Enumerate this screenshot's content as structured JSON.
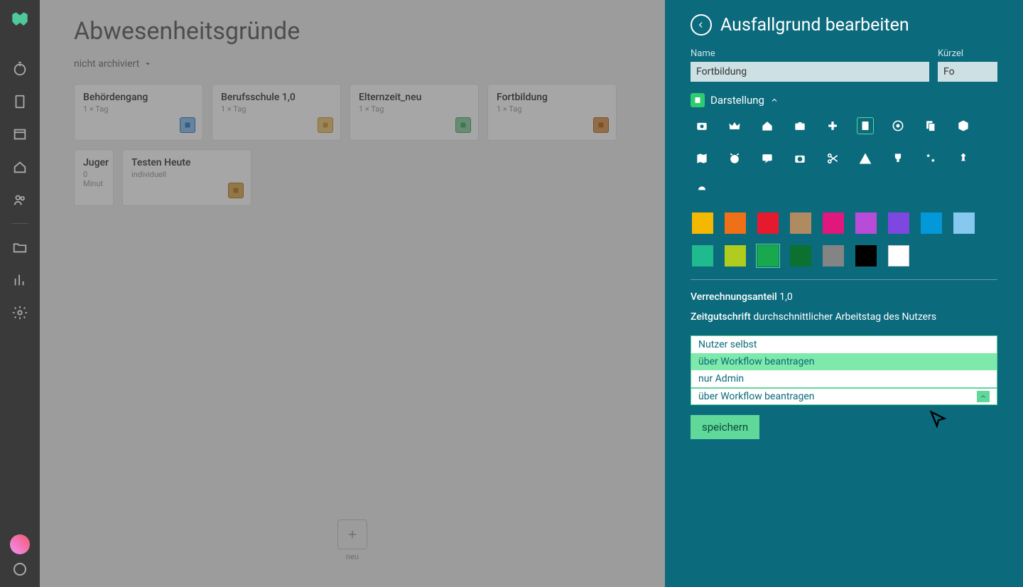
{
  "page": {
    "title": "Abwesenheitsgründe",
    "filter": "nicht archiviert",
    "newLabel": "neu"
  },
  "cards": [
    {
      "title": "Behördengang",
      "sub": "1 × Tag",
      "badgeColor": "#a3c9f0",
      "badgeBorder": "#4b8fd6"
    },
    {
      "title": "Berufsschule 1,0",
      "sub": "1 × Tag",
      "badgeColor": "#f0d090",
      "badgeBorder": "#d4a850"
    },
    {
      "title": "Elternzeit_neu",
      "sub": "1 × Tag",
      "badgeColor": "#9fd8b0",
      "badgeBorder": "#5dbb7f"
    },
    {
      "title": "Fortbildung",
      "sub": "1 × Tag",
      "badgeColor": "#e0a870",
      "badgeBorder": "#c07f3f"
    },
    {
      "title": "Juger",
      "sub": "0 Minut",
      "badgeColor": "",
      "badgeBorder": ""
    },
    {
      "title": "Testen Heute",
      "sub": "individuell",
      "badgeColor": "#e0b870",
      "badgeBorder": "#c0903f"
    }
  ],
  "panel": {
    "title": "Ausfallgrund bearbeiten",
    "nameLabel": "Name",
    "nameValue": "Fortbildung",
    "kurzelLabel": "Kürzel",
    "kurzelValue": "Fo",
    "displayLabel": "Darstellung",
    "colors": [
      "#f5b800",
      "#f07018",
      "#e51a2f",
      "#b08a60",
      "#e0187e",
      "#b84cd8",
      "#7e48e0",
      "#0398d8",
      "#87c8f0",
      "#1fba8e",
      "#b0cc1f",
      "#1aa84f",
      "#0c7030",
      "#848484",
      "#000000",
      "#ffffff"
    ],
    "selectedColorIndex": 11,
    "verrech": {
      "label": "Verrechnungsanteil",
      "value": "1,0"
    },
    "zeit": {
      "label": "Zeitgutschrift",
      "value": "durchschnittlicher Arbeitstag des Nutzers"
    },
    "dropdown": {
      "options": [
        "Nutzer selbst",
        "über Workflow beantragen",
        "nur Admin"
      ],
      "highlighted": 1,
      "current": "über Workflow beantragen"
    },
    "saveLabel": "speichern"
  }
}
